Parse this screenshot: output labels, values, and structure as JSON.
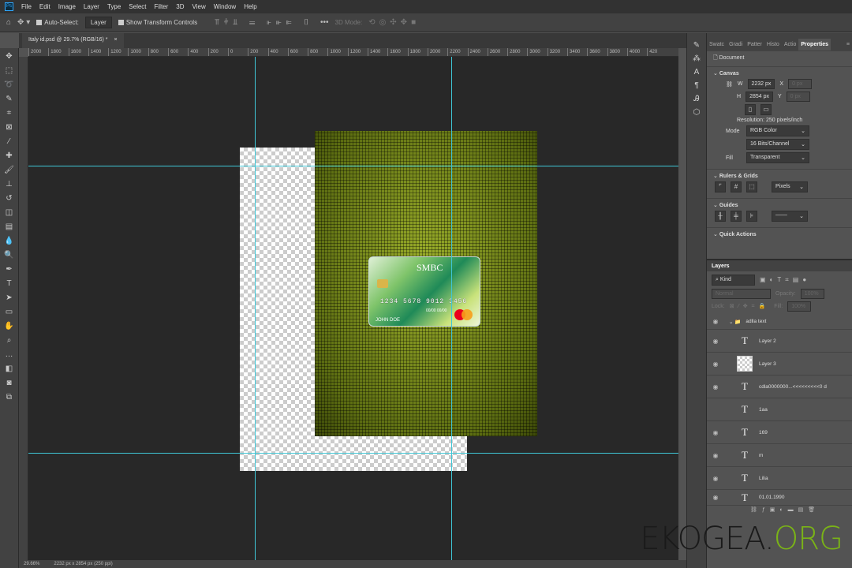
{
  "menu": [
    "File",
    "Edit",
    "Image",
    "Layer",
    "Type",
    "Select",
    "Filter",
    "3D",
    "View",
    "Window",
    "Help"
  ],
  "options": {
    "auto_select": "Auto-Select:",
    "auto_select_target": "Layer",
    "show_transform": "Show Transform Controls",
    "mode_3d": "3D Mode:"
  },
  "doc_tab": "Italy id.psd @ 29.7% (RGB/16) *",
  "ruler_labels": [
    "2000",
    "1800",
    "1600",
    "1400",
    "1200",
    "1000",
    "800",
    "600",
    "400",
    "200",
    "0",
    "200",
    "400",
    "600",
    "800",
    "1000",
    "1200",
    "1400",
    "1600",
    "1800",
    "2000",
    "2200",
    "2400",
    "2600",
    "2800",
    "3000",
    "3200",
    "3400",
    "3600",
    "3800",
    "4000",
    "420"
  ],
  "card": {
    "brand": "SMBC",
    "number": "1234  5678  9012  3456",
    "expiry": "00/00   00/00",
    "holder": "JOHN DOE",
    "network": "mastercard"
  },
  "status": {
    "zoom": "29.66%",
    "size": "2232 px x 2854 px (250 ppi)"
  },
  "panel": {
    "tabs": [
      "Swatc",
      "Gradi",
      "Patter",
      "Histo",
      "Actio",
      "Properties"
    ],
    "document": "Document",
    "canvas": {
      "title": "Canvas",
      "w_label": "W",
      "w": "2232 px",
      "h_label": "H",
      "h": "2854 px",
      "x_label": "X",
      "y_label": "Y",
      "x": "0 px",
      "y": "0 px",
      "resolution": "Resolution: 250 pixels/inch",
      "mode_label": "Mode",
      "mode": "RGB Color",
      "depth": "16 Bits/Channel",
      "fill_label": "Fill",
      "fill": "Transparent"
    },
    "rulers": {
      "title": "Rulers & Grids",
      "unit": "Pixels"
    },
    "guides": {
      "title": "Guides"
    },
    "quick_actions": {
      "title": "Quick Actions"
    }
  },
  "layers": {
    "title": "Layers",
    "kind": "Kind",
    "blend": "Normal",
    "opacity_label": "Opacity:",
    "opacity": "100%",
    "lock_label": "Lock:",
    "fill_label": "Fill:",
    "fill": "100%",
    "items": [
      {
        "name": "adlla text",
        "type": "group"
      },
      {
        "name": "Layer 2",
        "type": "text"
      },
      {
        "name": "Layer 3",
        "type": "raster"
      },
      {
        "name": "cdla0000000...<<<<<<<<<0 d",
        "type": "text"
      },
      {
        "name": "1aa",
        "type": "text"
      },
      {
        "name": "169",
        "type": "text"
      },
      {
        "name": "m",
        "type": "text"
      },
      {
        "name": "Lilia",
        "type": "text"
      },
      {
        "name": "01.01.1990",
        "type": "text"
      }
    ]
  },
  "watermark": {
    "part1": "EKOGEA.",
    "part2": "ORG",
    "color1": "#1a1a1a",
    "color2": "#7ab317"
  }
}
